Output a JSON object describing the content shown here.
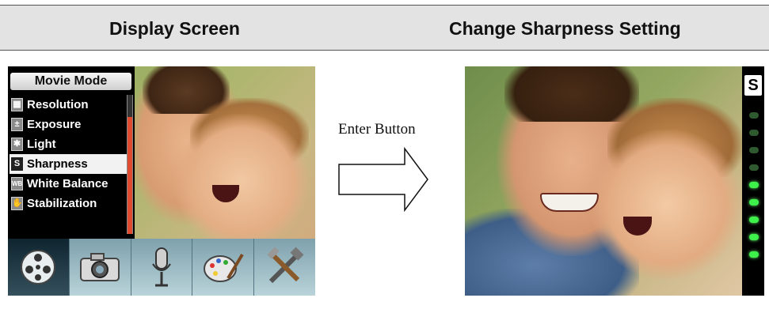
{
  "header": {
    "left_title": "Display Screen",
    "right_title": "Change Sharpness Setting"
  },
  "menu": {
    "title": "Movie Mode",
    "items": [
      {
        "label": "Resolution",
        "icon": "resolution-icon",
        "selected": false
      },
      {
        "label": "Exposure",
        "icon": "exposure-icon",
        "selected": false
      },
      {
        "label": "Light",
        "icon": "light-icon",
        "selected": false
      },
      {
        "label": "Sharpness",
        "icon": "sharpness-icon",
        "selected": true,
        "badge": "S"
      },
      {
        "label": "White Balance",
        "icon": "white-balance-icon",
        "selected": false,
        "badge": "WB"
      },
      {
        "label": "Stabilization",
        "icon": "stabilization-icon",
        "selected": false
      }
    ],
    "tabs": [
      {
        "icon": "film-reel-icon",
        "active": true
      },
      {
        "icon": "camera-icon",
        "active": false
      },
      {
        "icon": "microphone-icon",
        "active": false
      },
      {
        "icon": "palette-icon",
        "active": false
      },
      {
        "icon": "tools-icon",
        "active": false
      }
    ]
  },
  "arrow": {
    "label": "Enter Button"
  },
  "sharpness": {
    "badge": "S",
    "total_levels": 9,
    "active_levels": 5
  },
  "colors": {
    "menu_scroll_accent": "#e04a2f",
    "level_on": "#3df04a",
    "header_bg": "#e3e3e3"
  }
}
